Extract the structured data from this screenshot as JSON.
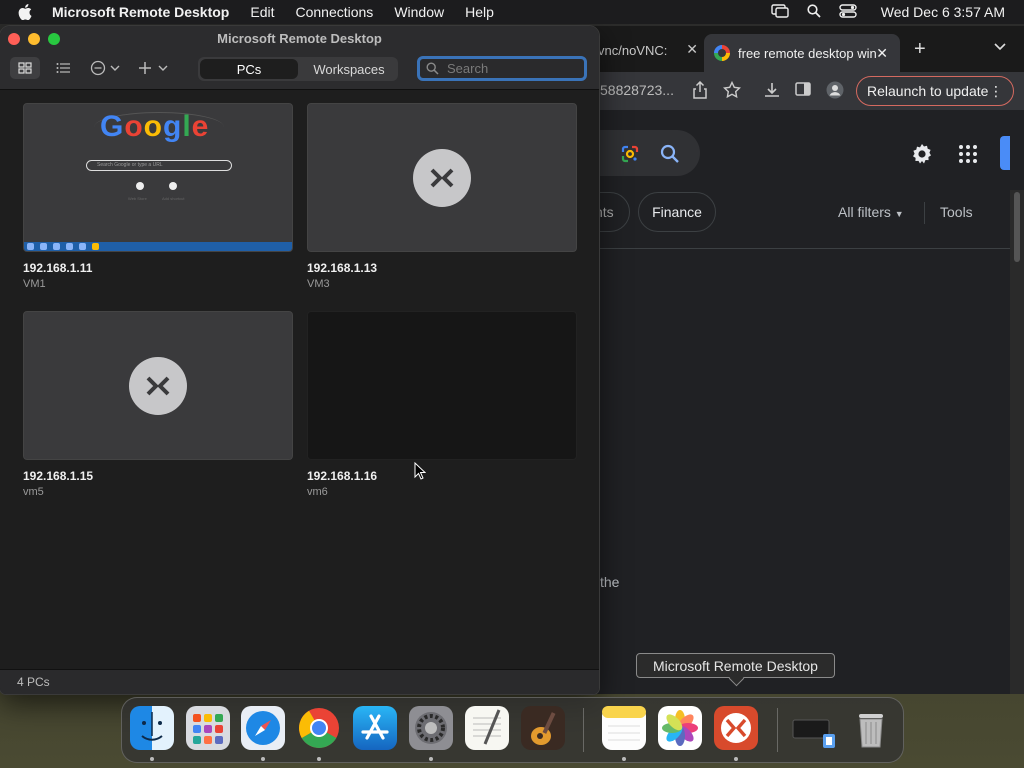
{
  "menubar": {
    "app_name": "Microsoft Remote Desktop",
    "menus": [
      "Edit",
      "Connections",
      "Window",
      "Help"
    ],
    "clock": "Wed Dec 6  3:57 AM"
  },
  "browser": {
    "tab1_title": "vnc/noVNC:",
    "tab2_title": "free remote desktop win",
    "url_fragment": "58828723...",
    "relaunch_label": "Relaunch to update",
    "chip_partial": "nts",
    "chip_finance": "Finance",
    "all_filters": "All filters",
    "tools": "Tools",
    "snippet": "the"
  },
  "rdwin": {
    "title": "Microsoft Remote Desktop",
    "tabs": [
      "PCs",
      "Workspaces"
    ],
    "search_placeholder": "Search",
    "footer": "4 PCs",
    "pcs": [
      {
        "ip": "192.168.1.11",
        "name": "VM1"
      },
      {
        "ip": "192.168.1.13",
        "name": "VM3"
      },
      {
        "ip": "192.168.1.15",
        "name": "vm5"
      },
      {
        "ip": "192.168.1.16",
        "name": "vm6"
      }
    ],
    "thumb_google": {
      "logo_letters": [
        "G",
        "o",
        "o",
        "g",
        "l",
        "e"
      ],
      "search_text": "Search Google or type a URL",
      "shortcut1": "Web Store",
      "shortcut2": "Add shortcut"
    }
  },
  "tooltip": "Microsoft Remote Desktop",
  "dock": {
    "items": [
      "Finder",
      "Launchpad",
      "Safari",
      "Google Chrome",
      "App Store",
      "System Settings",
      "TextEdit",
      "GarageBand",
      "Notes",
      "Photos",
      "Microsoft Remote Desktop",
      "Downloads",
      "Trash"
    ]
  }
}
